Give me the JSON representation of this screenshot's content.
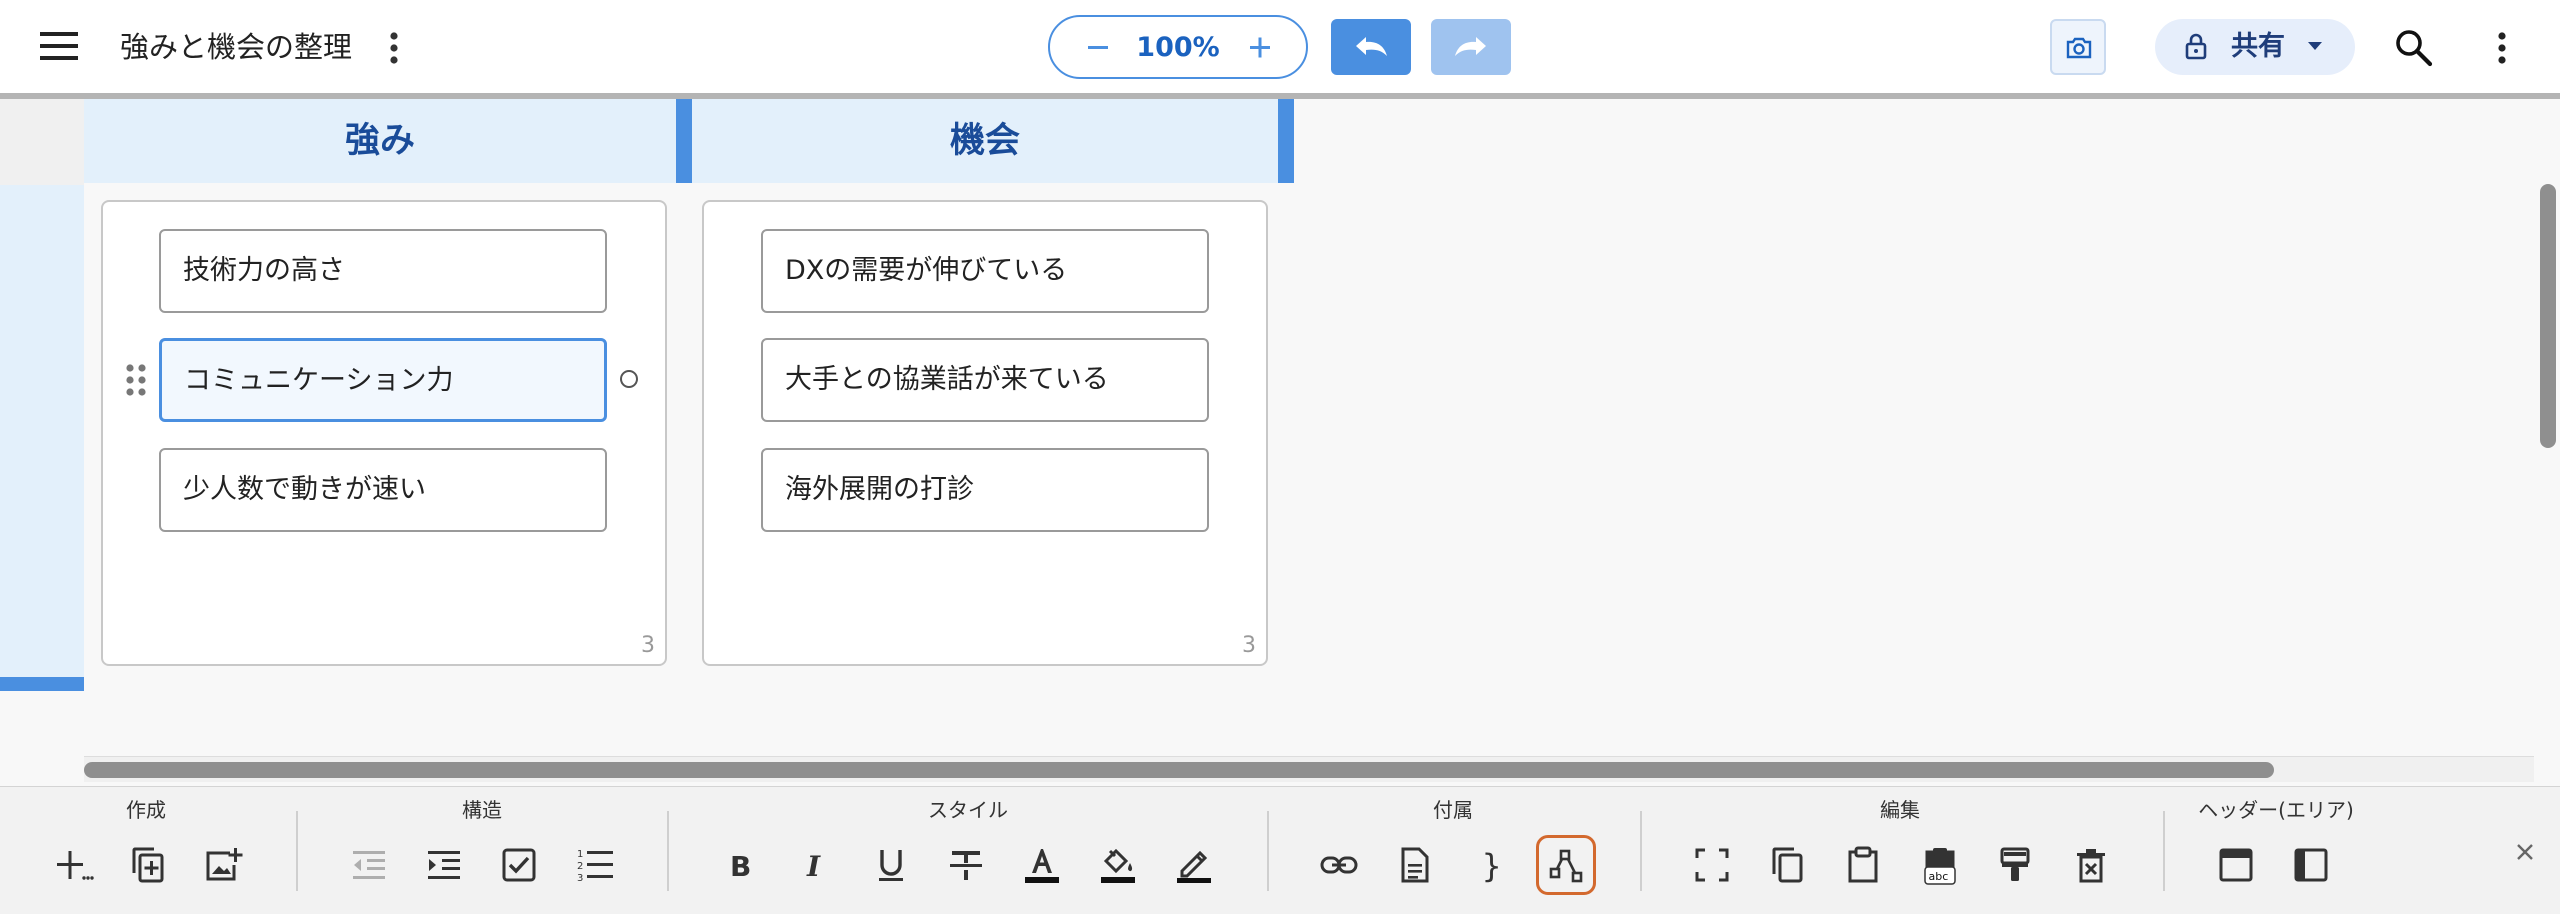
{
  "header": {
    "title": "強みと機会の整理",
    "zoom": "100%",
    "share_label": "共有",
    "icons": [
      "hamburger-menu-icon",
      "more-vertical-icon",
      "minus-icon",
      "plus-icon",
      "undo-icon",
      "redo-icon",
      "camera-icon",
      "lock-icon",
      "caret-down-icon",
      "search-icon"
    ]
  },
  "board": {
    "columns": [
      {
        "label": "強み",
        "count": "3",
        "cards": [
          "技術力の高さ",
          "コミュニケーション力",
          "少人数で動きが速い"
        ],
        "selected_index": 1
      },
      {
        "label": "機会",
        "count": "3",
        "cards": [
          "DXの需要が伸びている",
          "大手との協業話が来ている",
          "海外展開の打診"
        ]
      }
    ]
  },
  "toolbar": {
    "groups": {
      "create": "作成",
      "structure": "構造",
      "style": "スタイル",
      "attach": "付属",
      "edit": "編集",
      "header_area": "ヘッダー(エリア)"
    },
    "highlighted_tool": "relation-tool"
  },
  "colors": {
    "accent": "#4a8fe0",
    "header_fill": "#e3f0fb",
    "header_text": "#1a4c99",
    "highlight_border": "#d3692e"
  }
}
